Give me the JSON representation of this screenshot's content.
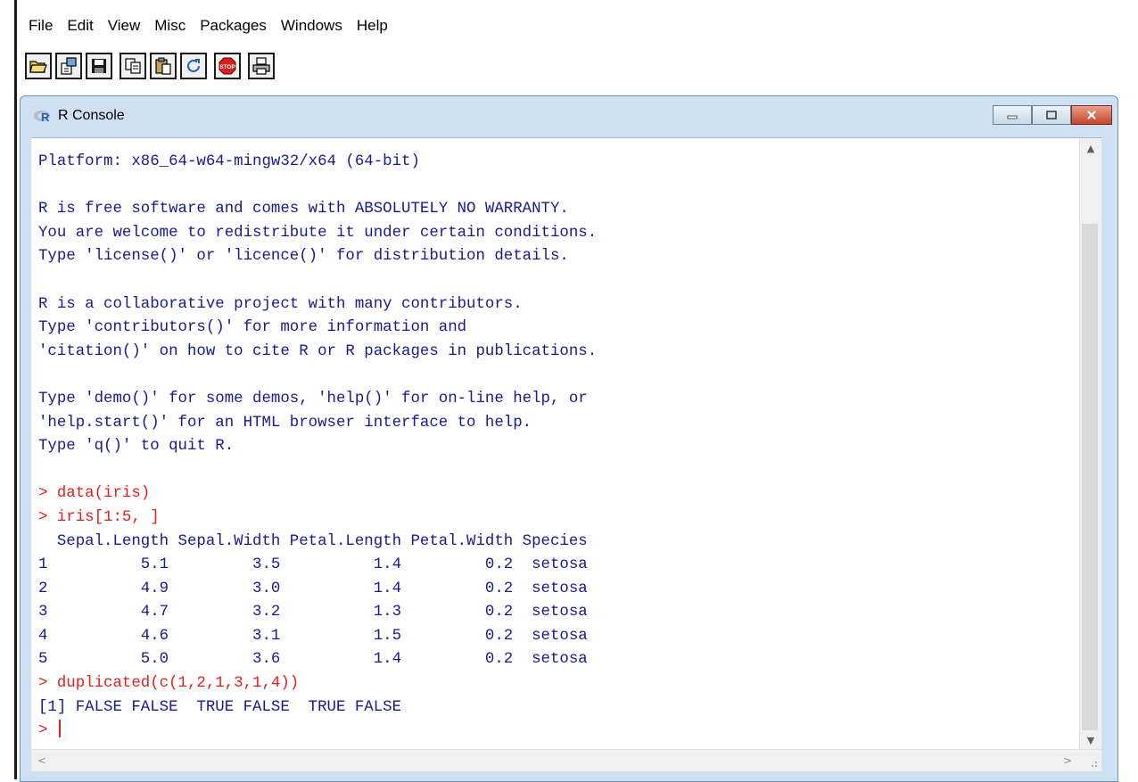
{
  "menu": [
    "File",
    "Edit",
    "View",
    "Misc",
    "Packages",
    "Windows",
    "Help"
  ],
  "toolbar": {
    "groups": [
      [
        "open-script-icon",
        "load-workspace-icon",
        "save-icon"
      ],
      [
        "copy-icon",
        "paste-icon",
        "refresh-icon"
      ],
      [
        "stop-icon"
      ],
      [
        "print-icon"
      ]
    ],
    "stop_label": "STOP"
  },
  "window": {
    "title": "R Console",
    "icon": "r-logo-icon"
  },
  "console": {
    "lines": [
      {
        "type": "output",
        "text": "Platform: x86_64-w64-mingw32/x64 (64-bit)"
      },
      {
        "type": "output",
        "text": ""
      },
      {
        "type": "output",
        "text": "R is free software and comes with ABSOLUTELY NO WARRANTY."
      },
      {
        "type": "output",
        "text": "You are welcome to redistribute it under certain conditions."
      },
      {
        "type": "output",
        "text": "Type 'license()' or 'licence()' for distribution details."
      },
      {
        "type": "output",
        "text": ""
      },
      {
        "type": "output",
        "text": "R is a collaborative project with many contributors."
      },
      {
        "type": "output",
        "text": "Type 'contributors()' for more information and"
      },
      {
        "type": "output",
        "text": "'citation()' on how to cite R or R packages in publications."
      },
      {
        "type": "output",
        "text": ""
      },
      {
        "type": "output",
        "text": "Type 'demo()' for some demos, 'help()' for on-line help, or"
      },
      {
        "type": "output",
        "text": "'help.start()' for an HTML browser interface to help."
      },
      {
        "type": "output",
        "text": "Type 'q()' to quit R."
      },
      {
        "type": "output",
        "text": ""
      },
      {
        "type": "input",
        "text": "> data(iris)"
      },
      {
        "type": "input",
        "text": "> iris[1:5, ]"
      },
      {
        "type": "output",
        "text": "  Sepal.Length Sepal.Width Petal.Length Petal.Width Species"
      },
      {
        "type": "output",
        "text": "1          5.1         3.5          1.4         0.2  setosa"
      },
      {
        "type": "output",
        "text": "2          4.9         3.0          1.4         0.2  setosa"
      },
      {
        "type": "output",
        "text": "3          4.7         3.2          1.3         0.2  setosa"
      },
      {
        "type": "output",
        "text": "4          4.6         3.1          1.5         0.2  setosa"
      },
      {
        "type": "output",
        "text": "5          5.0         3.6          1.4         0.2  setosa"
      },
      {
        "type": "input",
        "text": "> duplicated(c(1,2,1,3,1,4))"
      },
      {
        "type": "output",
        "text": "[1] FALSE FALSE  TRUE FALSE  TRUE FALSE"
      }
    ],
    "prompt": "> "
  },
  "colors": {
    "output_text": "#1a1a8c",
    "input_text": "#e02020",
    "window_frame": "#cfe0f2",
    "close_button": "#c2452a"
  }
}
